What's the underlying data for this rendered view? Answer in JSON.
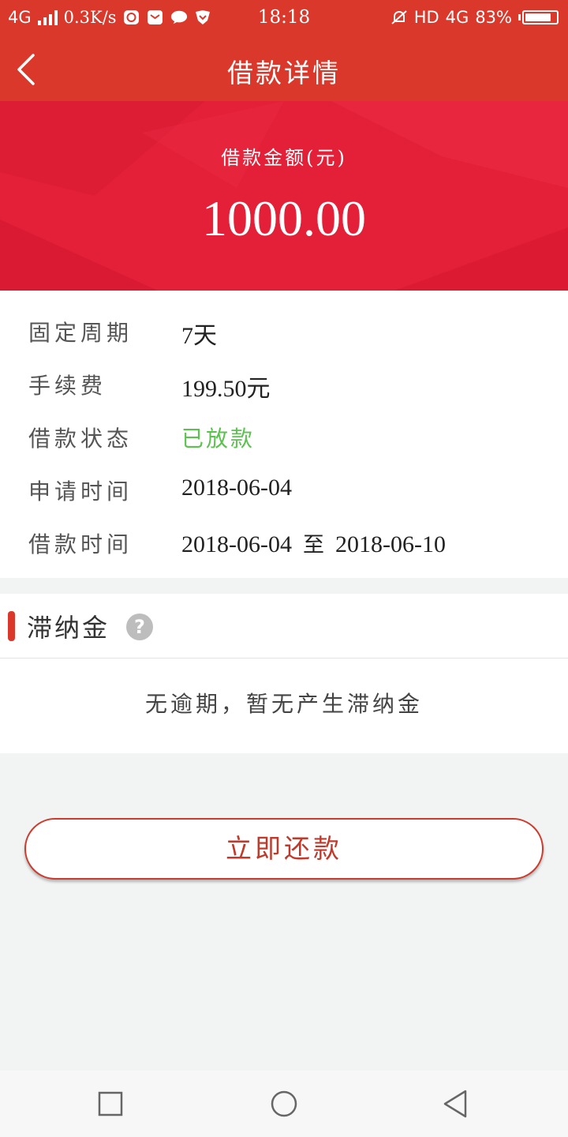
{
  "status_bar": {
    "network_left": "4G",
    "speed": "0.3K/s",
    "time": "18:18",
    "hd": "HD",
    "network_right": "4G",
    "battery": "83%",
    "battery_level": 0.83
  },
  "header": {
    "title": "借款详情"
  },
  "hero": {
    "label": "借款金额(元)",
    "amount": "1000.00"
  },
  "details": {
    "rows": [
      {
        "key": "固定周期",
        "value": "7天"
      },
      {
        "key": "手续费",
        "value": "199.50元"
      },
      {
        "key": "借款状态",
        "value": "已放款"
      },
      {
        "key": "申请时间",
        "value": "2018-06-04"
      },
      {
        "key": "借款时间",
        "value_from": "2018-06-04",
        "separator": "至",
        "value_to": "2018-06-10"
      }
    ]
  },
  "late_fee": {
    "title": "滞纳金",
    "help_symbol": "?",
    "message": "无逾期，暂无产生滞纳金"
  },
  "actions": {
    "repay_label": "立即还款"
  },
  "colors": {
    "brand_red": "#d9382a",
    "hero_red": "#e32038",
    "status_green": "#5cc24f"
  },
  "icons": {
    "back": "chevron-left-icon",
    "help": "question-mark-icon",
    "recent_apps": "square-icon",
    "home": "circle-icon",
    "system_back": "triangle-left-icon"
  }
}
